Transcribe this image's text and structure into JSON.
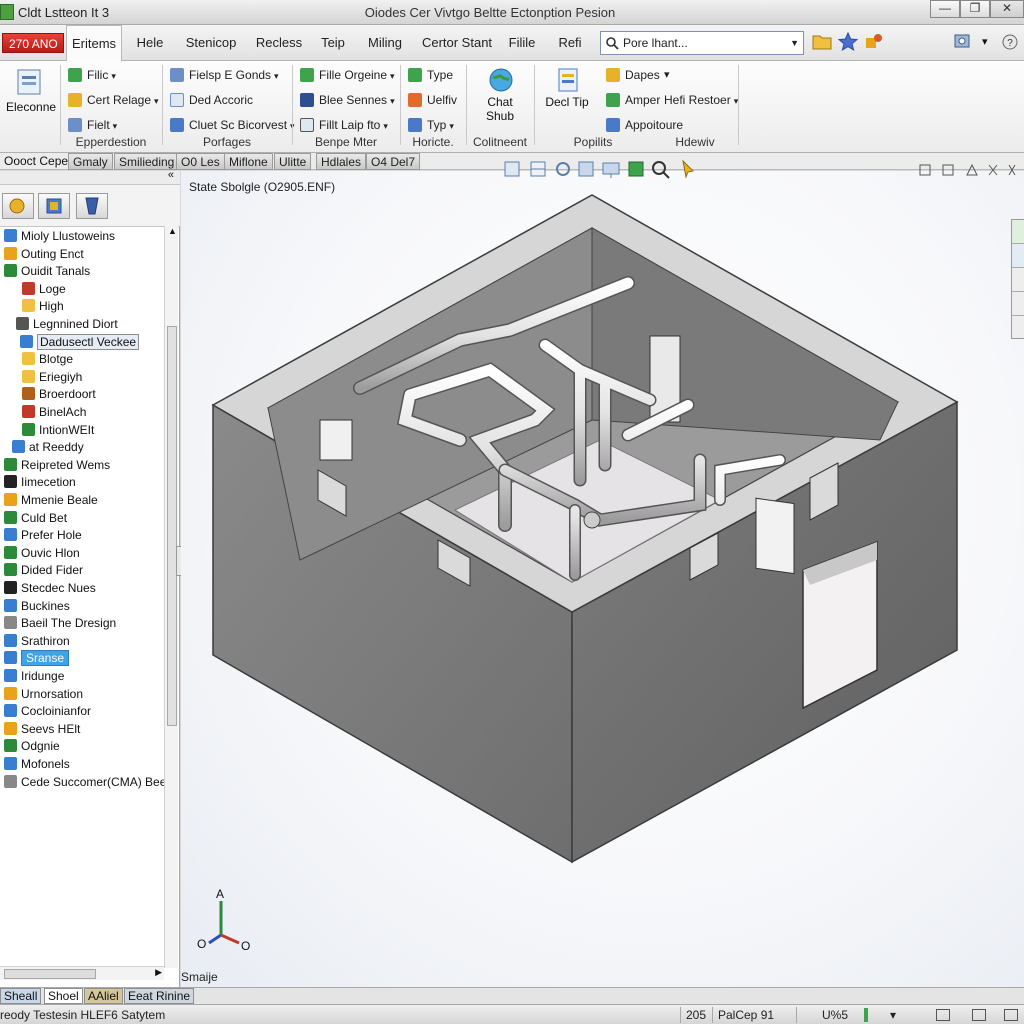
{
  "window": {
    "app_title": "Cldt Lstteon It 3",
    "doc_title": "Oiodes Cer Vivtgo Beltte Ectonption Pesion",
    "controls": {
      "minimize": "—",
      "maximize": "❐",
      "close": "✕"
    }
  },
  "menubar": {
    "brand": "270 ANO",
    "tabs": [
      "Eritems",
      "Hele",
      "Stenicop",
      "Recless",
      "Teip",
      "Miling",
      "Certor Stant",
      "Filile",
      "Refi"
    ],
    "search_value": "Pore lhant...",
    "right_glyphs": [
      "▾"
    ]
  },
  "ribbon": {
    "big_button": "Eleconne",
    "col1": [
      "Filic",
      "Cert Relage",
      "Fielt"
    ],
    "col2": [
      "Fielsp E Gonds",
      "Ded Accoric",
      "Cluet Sc Bicorvest"
    ],
    "col3": [
      "Fille Orgeine",
      "Blee Sennes",
      "Fillt Laip fto"
    ],
    "col4": [
      "Type",
      "Uelfiv",
      "Typ"
    ],
    "col5": "Chat Shub",
    "col6": "Decl Tip",
    "col7": [
      "Dapes",
      "Amper",
      "Appoitoure"
    ],
    "col8": "Hefi Restoer",
    "groups": [
      "Epperdestion",
      "Porfages",
      "Benpe Mter",
      "Horicte.",
      "Colitneent",
      "Popilits",
      "Hdewiv"
    ]
  },
  "subtabs": {
    "left_label": "Oooct Cepe",
    "tabs": [
      "Gmaly",
      "Smilieding",
      "O0 Les",
      "Miflone",
      "Ulitte",
      "Hdlales",
      "O4 Del7"
    ]
  },
  "tree": {
    "items": [
      {
        "label": "Mioly Llustoweins",
        "icon": "folder-icon",
        "color": "#3a7fcf"
      },
      {
        "label": "Outing Enct",
        "icon": "feature-icon",
        "color": "#e8a31a"
      },
      {
        "label": "Ouidit Tanals",
        "icon": "tool-icon",
        "color": "#2d8a3a"
      },
      {
        "label": "Loge",
        "icon": "x-icon",
        "color": "#c0392b"
      },
      {
        "label": "High",
        "icon": "folder-icon",
        "color": "#f0c040"
      },
      {
        "label": "Legnnined Diort",
        "icon": "line-icon",
        "color": "#555555"
      },
      {
        "label": "Dadusectl Veckee",
        "icon": "sheet-icon",
        "color": "#3a7fcf"
      },
      {
        "label": "Blotge",
        "icon": "folder-icon",
        "color": "#f0c040"
      },
      {
        "label": "Eriegiyh",
        "icon": "folder-icon",
        "color": "#f0c040"
      },
      {
        "label": "Broerdoort",
        "icon": "gear-icon",
        "color": "#b0601a"
      },
      {
        "label": "BinelAch",
        "icon": "part-icon",
        "color": "#c0392b"
      },
      {
        "label": "IntionWEIt",
        "icon": "sheet-icon",
        "color": "#2d8a3a"
      },
      {
        "label": "at Reeddy",
        "icon": "search-icon",
        "color": "#3a7fcf"
      },
      {
        "label": "Reipreted Wems",
        "icon": "shield-icon",
        "color": "#2d8a3a"
      },
      {
        "label": "Iimecetion",
        "icon": "block-icon",
        "color": "#222222"
      },
      {
        "label": "Mmenie Beale",
        "icon": "pencil-icon",
        "color": "#e8a31a"
      },
      {
        "label": "Culd Bet",
        "icon": "wrench-icon",
        "color": "#2d8a3a"
      },
      {
        "label": "Prefer Hole",
        "icon": "pencil-icon",
        "color": "#3a7fcf"
      },
      {
        "label": "Ouvic Hlon",
        "icon": "globe-icon",
        "color": "#2d8a3a"
      },
      {
        "label": "Dided Fider",
        "icon": "grid-icon",
        "color": "#2d8a3a"
      },
      {
        "label": "Stecdec Nues",
        "icon": "grid-icon",
        "color": "#222222"
      },
      {
        "label": "Buckines",
        "icon": "folder-icon",
        "color": "#3a7fcf"
      },
      {
        "label": "Baeil The Dresign",
        "icon": "globe-icon",
        "color": "#888888"
      },
      {
        "label": "Srathiron",
        "icon": "chart-icon",
        "color": "#3a7fcf"
      },
      {
        "label": "Sranse",
        "icon": "shield-icon",
        "color": "#3a7fcf"
      },
      {
        "label": "Iridunge",
        "icon": "block-icon",
        "color": "#3a7fcf"
      },
      {
        "label": "Urnorsation",
        "icon": "globe-icon",
        "color": "#e8a31a"
      },
      {
        "label": "Cocloinianfor",
        "icon": "tool-icon",
        "color": "#3a7fcf"
      },
      {
        "label": "Seevs HElt",
        "icon": "smile-icon",
        "color": "#e8a31a"
      },
      {
        "label": "Odgnie",
        "icon": "gear-icon",
        "color": "#2d8a3a"
      },
      {
        "label": "Mofonels",
        "icon": "sheet-icon",
        "color": "#3a7fcf"
      },
      {
        "label": "Cede Succomer(CMA) Beegs",
        "icon": "globe-icon",
        "color": "#888888"
      }
    ]
  },
  "viewport": {
    "title": "State Sbolgle (O2905.ENF)",
    "bottom_tab": "Smaije",
    "axis_labels": {
      "up": "A",
      "left": "O",
      "right": "O"
    }
  },
  "sheetbar": {
    "tabs": [
      "Sheall",
      "Shoel",
      "AAliel",
      "Eeat Rinine"
    ]
  },
  "status": {
    "left": "reody Testesin HLEF6 Satytem",
    "a": "205",
    "b": "PalCep 91",
    "c": "U%5",
    "d": "▾"
  }
}
